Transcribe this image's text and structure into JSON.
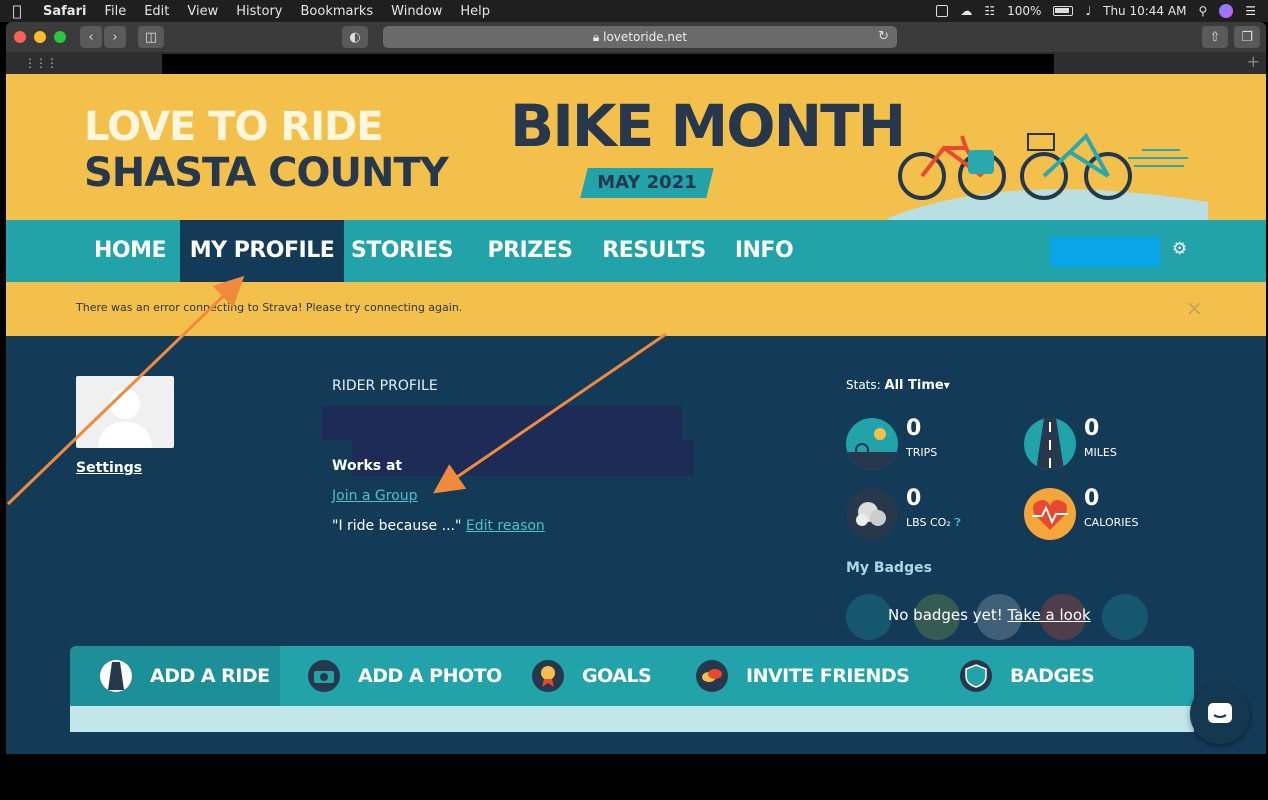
{
  "menubar": {
    "apple": "",
    "app": "Safari",
    "items": [
      "File",
      "Edit",
      "View",
      "History",
      "Bookmarks",
      "Window",
      "Help"
    ],
    "battery": "100%",
    "clock": "Thu 10:44 AM"
  },
  "browser": {
    "url": "lovetoride.net"
  },
  "hero": {
    "logo_line1": "LOVE TO RIDE",
    "logo_line2": "SHASTA COUNTY",
    "headline": "BIKE MONTH",
    "ribbon": "MAY 2021"
  },
  "nav": {
    "items": [
      {
        "label": "HOME"
      },
      {
        "label": "MY PROFILE"
      },
      {
        "label": "STORIES"
      },
      {
        "label": "PRIZES"
      },
      {
        "label": "RESULTS"
      },
      {
        "label": "INFO"
      }
    ],
    "active": "MY PROFILE"
  },
  "alert": {
    "message": "There was an error connecting to Strava! Please try connecting again.",
    "close": "×"
  },
  "profile": {
    "settings": "Settings",
    "section_title": "RIDER PROFILE",
    "works_at": "Works at",
    "join_group": "Join a Group",
    "ride_because": "\"I ride because ...\"",
    "edit_reason": "Edit reason"
  },
  "stats": {
    "label": "Stats:",
    "period": "All Time",
    "items": [
      {
        "value": "0",
        "label": "TRIPS"
      },
      {
        "value": "0",
        "label": "MILES"
      },
      {
        "value": "0",
        "label": "LBS CO₂"
      },
      {
        "value": "0",
        "label": "CALORIES"
      }
    ]
  },
  "badges": {
    "title": "My Badges",
    "empty_text": "No badges yet!",
    "take_look": "Take a look"
  },
  "tabs": [
    {
      "label": "ADD A RIDE"
    },
    {
      "label": "ADD A PHOTO"
    },
    {
      "label": "GOALS"
    },
    {
      "label": "INVITE FRIENDS"
    },
    {
      "label": "BADGES"
    }
  ],
  "colors": {
    "yellow": "#f4c04c",
    "teal": "#21a3a9",
    "navy": "#133b57",
    "link": "#4cc0d0",
    "annotation": "#f08a3c"
  }
}
